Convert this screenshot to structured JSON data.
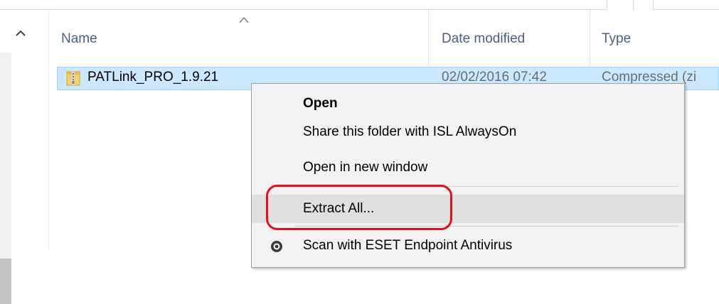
{
  "columns": {
    "name": "Name",
    "date_modified": "Date modified",
    "type": "Type"
  },
  "file": {
    "name": "PATLink_PRO_1.9.21",
    "date_modified": "02/02/2016 07:42",
    "type": "Compressed (zi",
    "icon": "zip-folder-icon"
  },
  "context_menu": {
    "items": [
      {
        "label": "Open",
        "bold": true
      },
      {
        "label": "Share this folder with ISL AlwaysOn"
      },
      {
        "label": "Open in new window"
      },
      {
        "label": "Extract All...",
        "highlighted": true
      },
      {
        "label": "Scan with ESET Endpoint Antivirus",
        "icon": "eset-scan-icon"
      }
    ]
  },
  "colors": {
    "selection_bg": "#cce8ff",
    "selection_border": "#99d1ff",
    "menu_bg": "#f2f2f2",
    "menu_highlight": "#e0e0e0",
    "annotation": "#e0111b",
    "header_text": "#4c607a",
    "detail_text": "#6d6d6d"
  }
}
